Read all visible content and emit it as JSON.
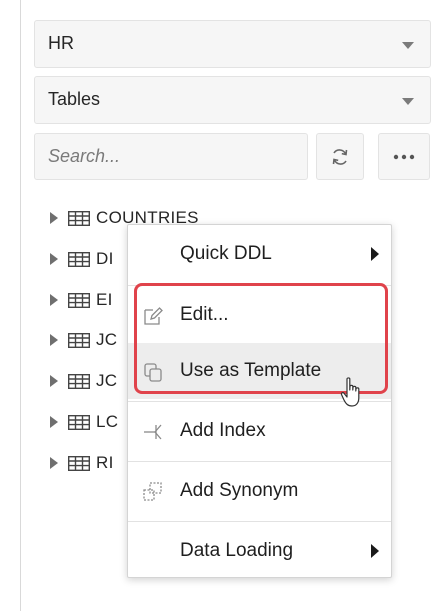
{
  "schema_select": {
    "value": "HR"
  },
  "type_select": {
    "value": "Tables"
  },
  "search": {
    "placeholder": "Search..."
  },
  "toolbar": {
    "refresh_icon": "refresh-icon",
    "more_icon": "ellipsis-icon"
  },
  "tree": {
    "items": [
      {
        "label": "COUNTRIES"
      },
      {
        "label": "DI"
      },
      {
        "label": "EI"
      },
      {
        "label": "JC"
      },
      {
        "label": "JC"
      },
      {
        "label": "LC"
      },
      {
        "label": "RI"
      }
    ]
  },
  "context_menu": {
    "items": [
      {
        "label": "Quick DDL",
        "icon": "",
        "submenu": true
      },
      {
        "label": "Edit...",
        "icon": "pencil-icon",
        "submenu": false
      },
      {
        "label": "Use as Template",
        "icon": "copy-icon",
        "submenu": false,
        "hovered": true
      },
      {
        "label": "Add Index",
        "icon": "index-arrow-icon",
        "submenu": false
      },
      {
        "label": "Add Synonym",
        "icon": "synonym-icon",
        "submenu": false
      },
      {
        "label": "Data Loading",
        "icon": "",
        "submenu": true
      }
    ]
  },
  "colors": {
    "highlight": "#e0434b",
    "hover_bg": "#ededed"
  }
}
